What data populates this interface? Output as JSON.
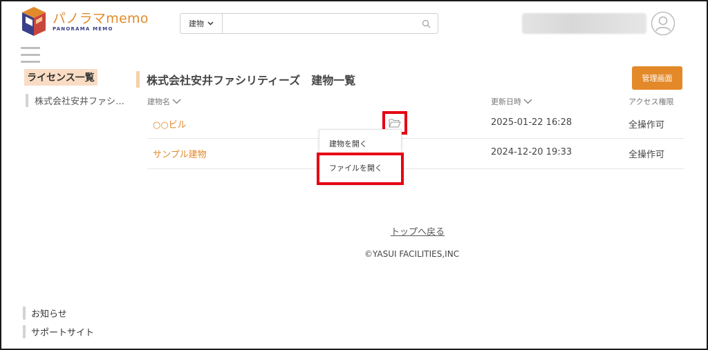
{
  "app": {
    "title": "パノラマmemo",
    "subtitle": "PANORAMA MEMO"
  },
  "search": {
    "category": "建物",
    "value": "",
    "placeholder": ""
  },
  "sidebar": {
    "title": "ライセンス一覧",
    "items": [
      {
        "label": "株式会社安井ファシ…"
      }
    ],
    "footer": [
      {
        "label": "お知らせ"
      },
      {
        "label": "サポートサイト"
      }
    ]
  },
  "main": {
    "title": "株式会社安井ファシリティーズ　建物一覧",
    "admin_button": "管理画面",
    "columns": {
      "name": "建物名",
      "updated": "更新日時",
      "access": "アクセス権限"
    },
    "rows": [
      {
        "name": "○○ビル",
        "updated": "2025-01-22 16:28",
        "access": "全操作可"
      },
      {
        "name": "サンプル建物",
        "updated": "2024-12-20 19:33",
        "access": "全操作可"
      }
    ],
    "context_menu": {
      "open_building": "建物を開く",
      "open_file": "ファイルを開く"
    }
  },
  "footer": {
    "back_to_top": "トップへ戻る",
    "copyright": "©YASUI FACILITIES,INC"
  },
  "colors": {
    "brand_orange": "#e08a2b",
    "brand_navy": "#39408a",
    "highlight_red": "#e60012"
  }
}
